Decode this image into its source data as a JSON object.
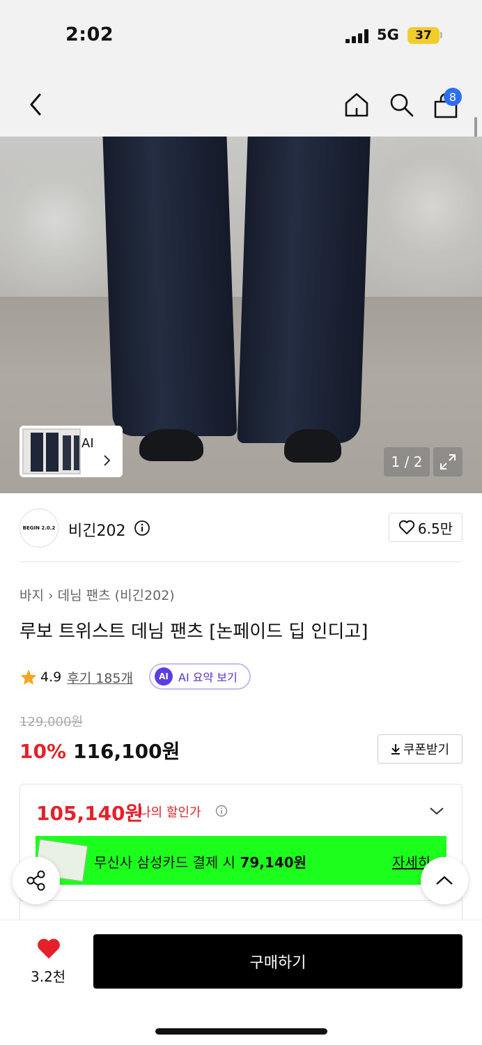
{
  "status_bar": {
    "time": "2:02",
    "network": "5G",
    "battery": "37"
  },
  "nav": {
    "cart_count": "8",
    "icons": [
      "back-icon",
      "home-icon",
      "search-icon",
      "cart-icon"
    ]
  },
  "gallery": {
    "thumb_label": "AI",
    "page_counter": "1 / 2"
  },
  "brand": {
    "logo_text": "BEGIN 2.0.2",
    "name": "비긴202",
    "likes": "6.5만"
  },
  "product": {
    "breadcrumb": [
      "바지",
      "데님 팬츠 (비긴202)"
    ],
    "title": "루보 트위스트 데님 팬츠 [논페이드 딥 인디고]",
    "rating": "4.9",
    "review_link": "후기 185개",
    "ai_badge": "AI",
    "ai_summary": "AI 요약 보기"
  },
  "price": {
    "original": "129,000원",
    "discount": "10%",
    "sale": "116,100원",
    "coupon_button": "쿠폰받기"
  },
  "benefit": {
    "my_price": "105,140원",
    "my_price_label": "나의 할인가",
    "card_text_prefix": "무신사 삼성카드 결제 시",
    "card_price": "79,140원",
    "card_detail": "자세히"
  },
  "bottom": {
    "wish_count": "3.2천",
    "buy_button": "구매하기"
  },
  "colors": {
    "accent_red": "#e6202a",
    "card_banner": "#1cff1c",
    "badge_blue": "#2d6ef5",
    "ai_purple": "#5b3ee0"
  }
}
